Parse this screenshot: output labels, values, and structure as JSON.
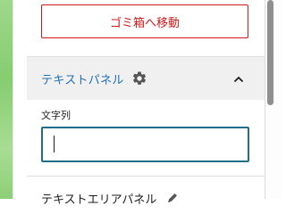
{
  "sidebar": {
    "trash_button_label": "ゴミ箱へ移動",
    "text_panel": {
      "title": "テキストパネル",
      "settings_icon": "gear-icon",
      "toggle_icon": "chevron-up-icon",
      "field_label": "文字列",
      "field_value": ""
    },
    "next_panel": {
      "title": "テキストエリアパネル",
      "icon": "pencil-icon"
    }
  },
  "colors": {
    "danger": "#cc1818",
    "accent": "#2271b1",
    "input_focus_border": "#1f6f8b"
  }
}
